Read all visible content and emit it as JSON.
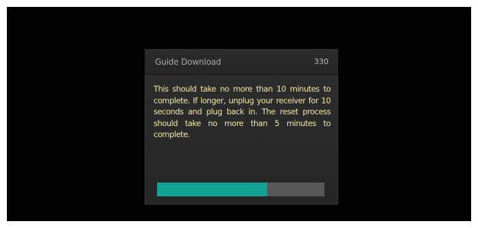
{
  "dialog": {
    "title": "Guide Download",
    "counter": "330",
    "message": "This should take no more than 10 minutes to complete. If longer, unplug your receiver for 10 seconds and plug back in. The reset process should take no more than 5 minutes to complete."
  },
  "progress": {
    "fraction": 0.66
  },
  "colors": {
    "screen_background": "#020202",
    "dialog_background": "#2b2b2b",
    "message_text": "#f2e9a6",
    "progress_fill": "#12a394",
    "progress_track": "#585858"
  }
}
